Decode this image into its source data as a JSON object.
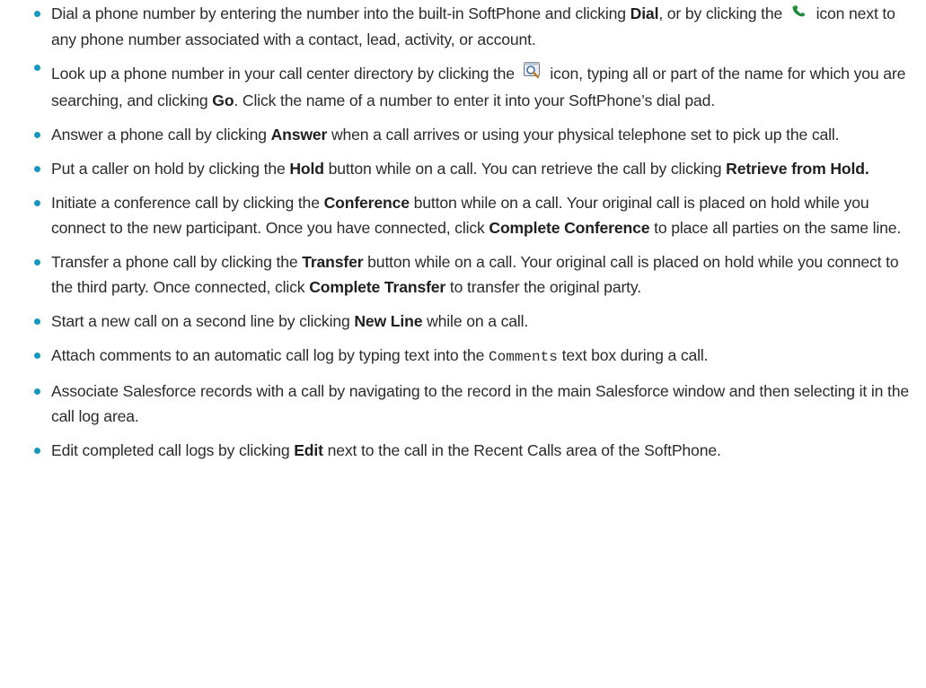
{
  "items": [
    {
      "a": "Dial a phone number by entering the number into the built-in SoftPhone and clicking ",
      "b": "Dial",
      "c": ", or by clicking the ",
      "d": " icon next to any phone number associated with a contact, lead, activity, or account.",
      "icon": "phone-handset-icon"
    },
    {
      "a": "Look up a phone number in your call center directory by clicking the ",
      "b": " icon, typing all or part of the name for which you are searching, and clicking ",
      "c": "Go",
      "d": ". Click the name of a number to enter it into your SoftPhone’s dial pad.",
      "icon": "directory-search-icon"
    },
    {
      "a": "Answer a phone call by clicking ",
      "b": "Answer",
      "c": " when a call arrives or using your physical telephone set to pick up the call."
    },
    {
      "a": "Put a caller on hold by clicking the ",
      "b": "Hold",
      "c": " button while on a call. You can retrieve the call by clicking ",
      "d": "Retrieve from Hold."
    },
    {
      "a": "Initiate a conference call by clicking the ",
      "b": "Conference",
      "c": " button while on a call. Your original call is placed on hold while you connect to the new participant. Once you have connected, click ",
      "d": "Complete Conference",
      "e": " to place all parties on the same line."
    },
    {
      "a": "Transfer a phone call by clicking the ",
      "b": "Transfer",
      "c": " button while on a call. Your original call is placed on hold while you connect to the third party. Once connected, click ",
      "d": "Complete Transfer",
      "e": " to transfer the original party."
    },
    {
      "a": "Start a new call on a second line by clicking ",
      "b": "New Line",
      "c": " while on a call."
    },
    {
      "a": "Attach comments to an automatic call log by typing text into the ",
      "b": "Comments",
      "c": " text box during a call."
    },
    {
      "a": "Associate Salesforce records with a call by navigating to the record in the main Salesforce window and then selecting it in the call log area."
    },
    {
      "a": "Edit completed call logs by clicking ",
      "b": "Edit",
      "c": " next to the call in the Recent Calls area of the SoftPhone."
    }
  ],
  "colors": {
    "bullet": "#1797c0",
    "text": "#2b2b2b",
    "phone_icon": "#1e8a3a"
  }
}
